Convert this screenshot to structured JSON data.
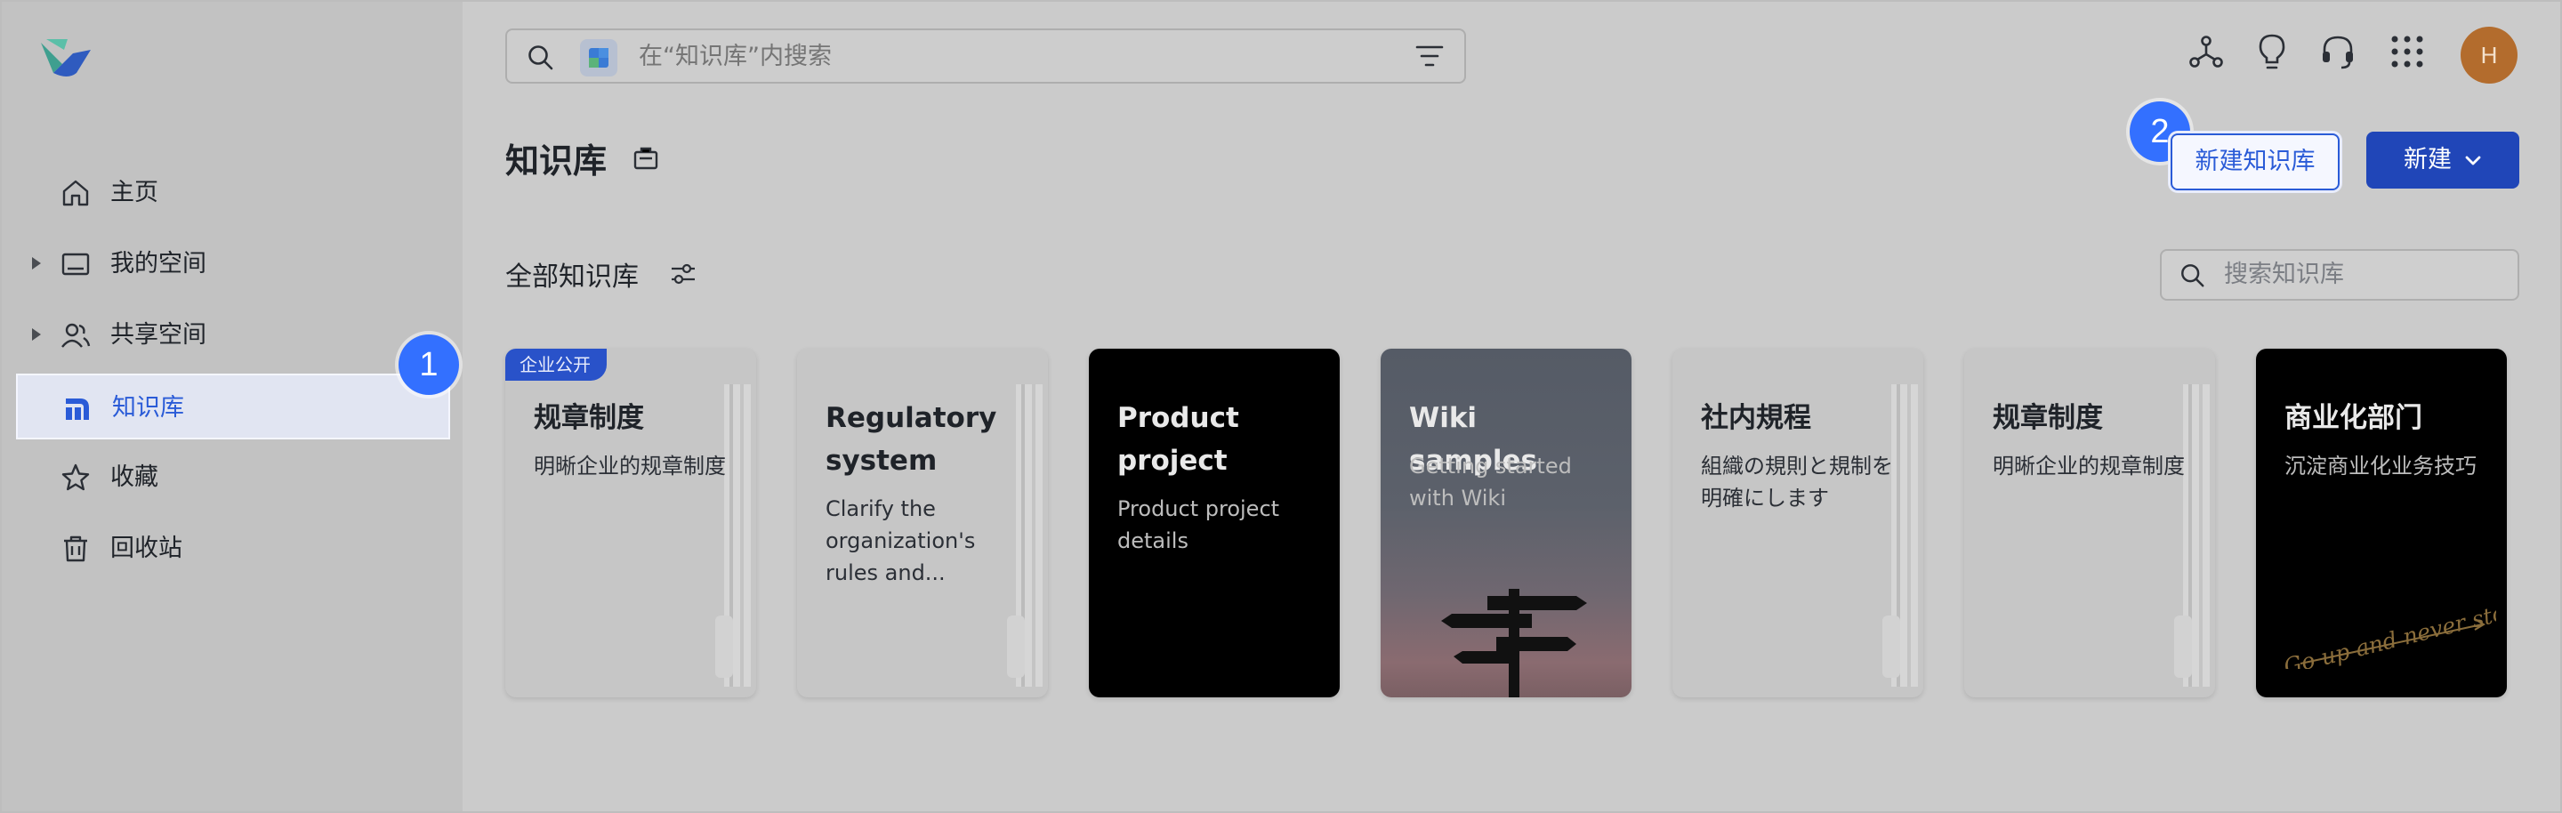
{
  "sidebar": {
    "items": [
      {
        "label": "主页",
        "icon": "home-icon"
      },
      {
        "label": "我的空间",
        "icon": "folder-icon",
        "expandable": true
      },
      {
        "label": "共享空间",
        "icon": "people-icon",
        "expandable": true
      },
      {
        "label": "知识库",
        "icon": "knowledge-base-icon",
        "active": true
      },
      {
        "label": "收藏",
        "icon": "star-icon"
      },
      {
        "label": "回收站",
        "icon": "trash-icon"
      }
    ]
  },
  "search": {
    "placeholder": "在“知识库”内搜索"
  },
  "header": {
    "avatar_initial": "H"
  },
  "page": {
    "title": "知识库",
    "section_title": "全部知识库",
    "kb_search_placeholder": "搜索知识库",
    "new_kb_button": "新建知识库",
    "new_button": "新建"
  },
  "steps": {
    "one": "1",
    "two": "2"
  },
  "cards": [
    {
      "tag": "企业公开",
      "title": "规章制度",
      "desc": "明晰企业的规章制度",
      "style": "light"
    },
    {
      "title": "Regulatory system",
      "desc": "Clarify the organization's rules and...",
      "style": "light"
    },
    {
      "title": "Product project",
      "desc": "Product project details",
      "style": "black"
    },
    {
      "title": "Wiki samples",
      "desc": "Getting started with Wiki",
      "style": "wiki"
    },
    {
      "title": "社内規程",
      "desc": "組織の規則と規制を明確にします",
      "style": "light"
    },
    {
      "title": "规章制度",
      "desc": "明晰企业的规章制度",
      "style": "light"
    },
    {
      "title": "商业化部门",
      "desc": "沉淀商业化业务技巧",
      "style": "black",
      "art_text": "Go up and never stop"
    }
  ],
  "colors": {
    "accent": "#2a5bd7",
    "primary_button": "#2046b8",
    "step_badge": "#3370ff",
    "avatar": "#b36c2d"
  }
}
